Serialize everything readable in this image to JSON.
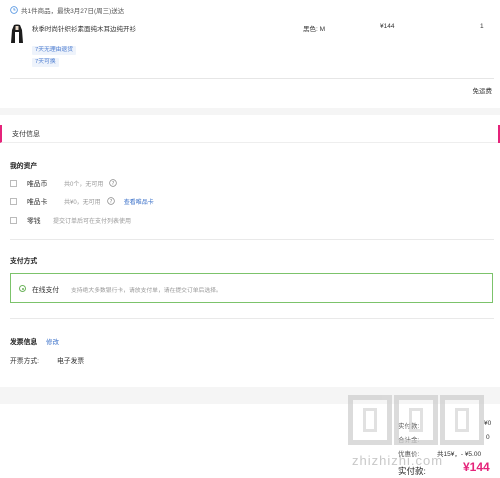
{
  "order": {
    "delivery_note": "共1件商品，最快3月27日(周三)送达",
    "product": {
      "name": "秋季时尚针织衫素面纯木耳边纯开衫",
      "color": "黑色: M",
      "price": "¥144",
      "qty": "1",
      "tags": [
        "7天无理由退货",
        "7天可换"
      ]
    },
    "shipping": "免运费"
  },
  "payment": {
    "title": "支付信息",
    "assets_title": "我的资产",
    "assets": [
      {
        "name": "唯品币",
        "hint": "共0个，无可用",
        "help": true
      },
      {
        "name": "唯品卡",
        "hint": "共¥0，无可用",
        "help": true,
        "link": "查看唯品卡"
      },
      {
        "name": "零钱",
        "hint": "提交订单后可在支付列表使用"
      }
    ],
    "method_title": "支付方式",
    "method": {
      "label": "在线支付",
      "desc": "支持绝大多数银行卡，请放支付单，请在提交订单后选择。"
    },
    "invoice_title": "发票信息",
    "invoice_edit": "修改",
    "invoice_type_label": "开票方式:",
    "invoice_type_value": "电子发票"
  },
  "summary": {
    "rows": [
      {
        "label": "实付款:",
        "value": "¥0"
      },
      {
        "label": "合计金:",
        "value": "0"
      },
      {
        "label": "优惠价:",
        "value": "共15¥，- ¥5.00"
      }
    ],
    "total_label": "实付款:",
    "total_value": "¥144"
  },
  "watermark": {
    "text": "zhizhizhi.com"
  },
  "colors": {
    "accent_pink": "#e5237a",
    "link_blue": "#3a70c9",
    "green_border": "#7cc36b"
  }
}
